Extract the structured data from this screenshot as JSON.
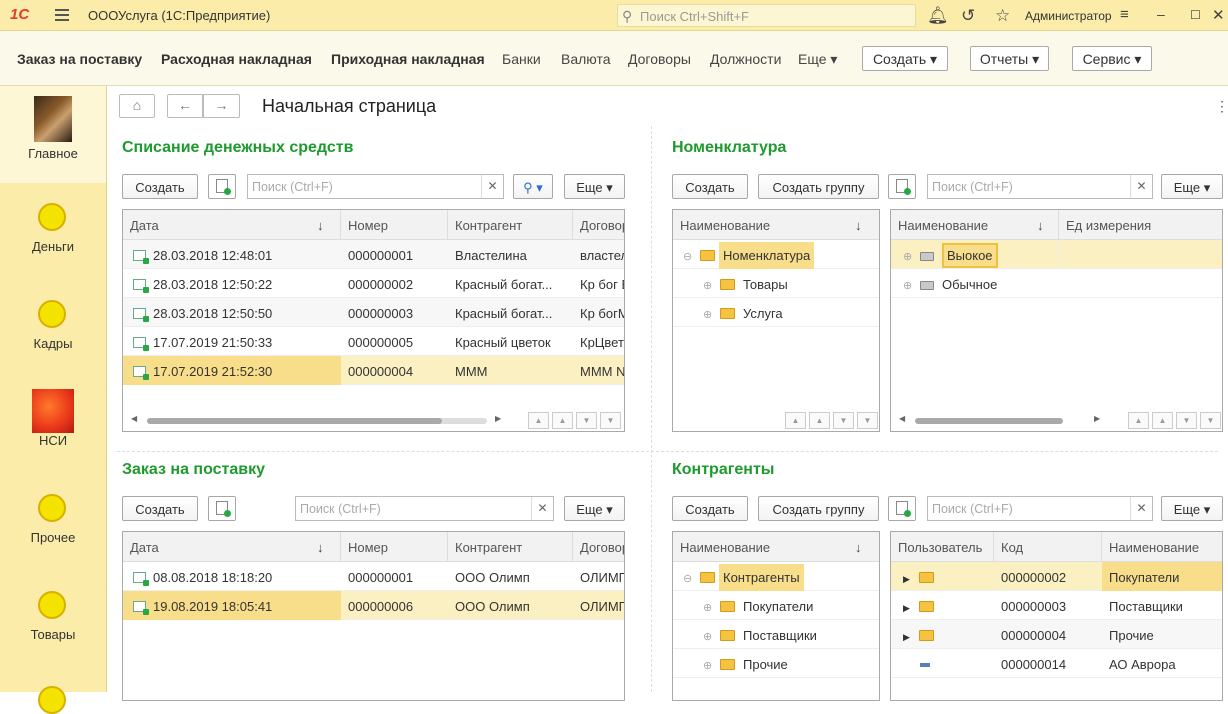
{
  "titlebar": {
    "logo": "1С",
    "app_title": "ОООУслуга  (1С:Предприятие)",
    "search_placeholder": "Поиск Ctrl+Shift+F",
    "user": "Администратор"
  },
  "sections": {
    "items": [
      "Заказ на поставку",
      "Расходная накладная",
      "Приходная накладная",
      "Банки",
      "Валюта",
      "Договоры",
      "Должности",
      "Еще ▾"
    ],
    "create": "Создать ▾",
    "reports": "Отчеты ▾",
    "service": "Сервис ▾"
  },
  "sidebar": {
    "items": [
      "Главное",
      "Деньги",
      "Кадры",
      "НСИ",
      "Прочее",
      "Товары"
    ]
  },
  "page": {
    "title": "Начальная страница"
  },
  "payments": {
    "title": "Списание денежных средств",
    "create": "Создать",
    "search_placeholder": "Поиск (Ctrl+F)",
    "more": "Еще ▾",
    "columns": [
      "Дата",
      "Номер",
      "Контрагент",
      "Договор"
    ],
    "rows": [
      [
        "28.03.2018 12:48:01",
        "000000001",
        "Властелина",
        "властел"
      ],
      [
        "28.03.2018 12:50:22",
        "000000002",
        "Красный богат...",
        "Кр бог В"
      ],
      [
        "28.03.2018 12:50:50",
        "000000003",
        "Красный богат...",
        "Кр богМ"
      ],
      [
        "17.07.2019 21:50:33",
        "000000005",
        "Красный цветок",
        "КрЦвет"
      ],
      [
        "17.07.2019 21:52:30",
        "000000004",
        "МММ",
        "МММ N"
      ]
    ]
  },
  "orders": {
    "title": "Заказ на поставку",
    "create": "Создать",
    "search_placeholder": "Поиск (Ctrl+F)",
    "more": "Еще ▾",
    "columns": [
      "Дата",
      "Номер",
      "Контрагент",
      "Договор"
    ],
    "rows": [
      [
        "08.08.2018 18:18:20",
        "000000001",
        "ООО Олимп",
        "ОЛИМП"
      ],
      [
        "19.08.2019 18:05:41",
        "000000006",
        "ООО Олимп",
        "ОЛИМП"
      ]
    ]
  },
  "nomenclature": {
    "title": "Номенклатура",
    "create": "Создать",
    "create_group": "Создать группу",
    "search_placeholder": "Поиск (Ctrl+F)",
    "more": "Еще ▾",
    "tree_col": "Наименование",
    "tree": [
      "Номенклатура",
      "Товары",
      "Услуга"
    ],
    "list_cols": [
      "Наименование",
      "Ед измерения"
    ],
    "list": [
      "Выокое",
      "Обычное"
    ]
  },
  "contractors": {
    "title": "Контрагенты",
    "create": "Создать",
    "create_group": "Создать группу",
    "search_placeholder": "Поиск (Ctrl+F)",
    "more": "Еще ▾",
    "tree_col": "Наименование",
    "tree": [
      "Контрагенты",
      "Покупатели",
      "Поставщики",
      "Прочие"
    ],
    "list_cols": [
      "Пользователь",
      "Код",
      "Наименование"
    ],
    "list": [
      [
        "000000002",
        "Покупатели"
      ],
      [
        "000000003",
        "Поставщики"
      ],
      [
        "000000004",
        "Прочие"
      ],
      [
        "000000014",
        "АО Аврора"
      ]
    ]
  }
}
